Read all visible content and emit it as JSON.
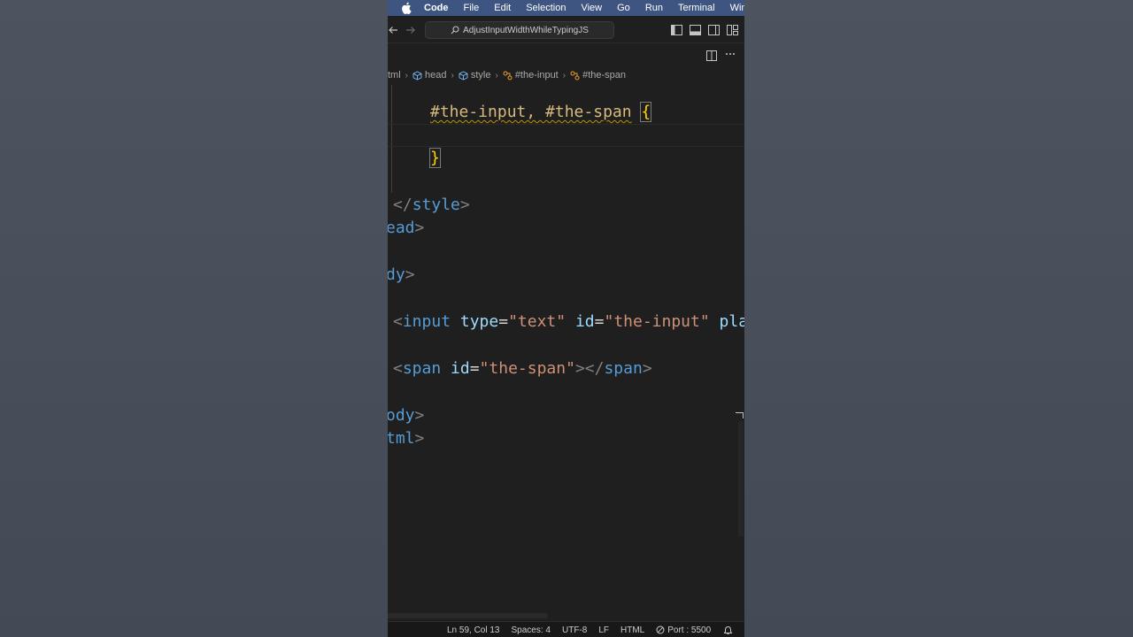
{
  "menubar": {
    "app": "Code",
    "items": [
      "File",
      "Edit",
      "Selection",
      "View",
      "Go",
      "Run",
      "Terminal",
      "Wind"
    ]
  },
  "titlebar": {
    "search_text": "AdjustInputWidthWhileTypingJS"
  },
  "breadcrumb": {
    "items": [
      "tml",
      "head",
      "style",
      "#the-input",
      "#the-span"
    ]
  },
  "editor": {
    "lines": {
      "l1_sel": "#the-input, #the-span",
      "l1_brace": "{",
      "l3_brace": "}",
      "l5_open": "</",
      "l5_tag": "style",
      "l5_close": ">",
      "l6_tag": "ead",
      "l6_close": ">",
      "l8_tag": "dy",
      "l8_close": ">",
      "l10_open": "<",
      "l10_tag": "input",
      "l10_attr1": "type",
      "l10_eq1": "=",
      "l10_val1": "\"text\"",
      "l10_attr2": "id",
      "l10_eq2": "=",
      "l10_val2": "\"the-input\"",
      "l10_attr3": "plac",
      "l12_open": "<",
      "l12_tag": "span",
      "l12_attr": "id",
      "l12_eq": "=",
      "l12_val": "\"the-span\"",
      "l12_mid": "></",
      "l12_tag2": "span",
      "l12_close": ">",
      "l14_tag": "ody",
      "l14_close": ">",
      "l15_tag": "tml",
      "l15_close": ">"
    }
  },
  "statusbar": {
    "position": "Ln 59, Col 13",
    "spaces": "Spaces: 4",
    "encoding": "UTF-8",
    "eol": "LF",
    "language": "HTML",
    "port": "Port : 5500"
  },
  "colors": {
    "menubar": "#3d5580",
    "editor_bg": "#1f1f1f",
    "selector": "#d7ba7d",
    "tag": "#569cd6",
    "attr": "#9cdcfe",
    "string": "#ce9178"
  }
}
